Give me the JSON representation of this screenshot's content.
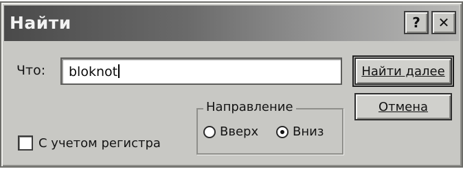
{
  "window": {
    "title": "Найти",
    "help_label": "?",
    "close_label": "✕"
  },
  "search": {
    "label": "Что:",
    "value": "bloknot"
  },
  "buttons": {
    "find_next": "Найти далее",
    "cancel": "Отмена"
  },
  "direction": {
    "legend": "Направление",
    "up_label": "Вверх",
    "down_label": "Вниз",
    "selected": "Вниз"
  },
  "options": {
    "match_case_label": "С учетом регистра",
    "match_case_checked": false
  }
}
